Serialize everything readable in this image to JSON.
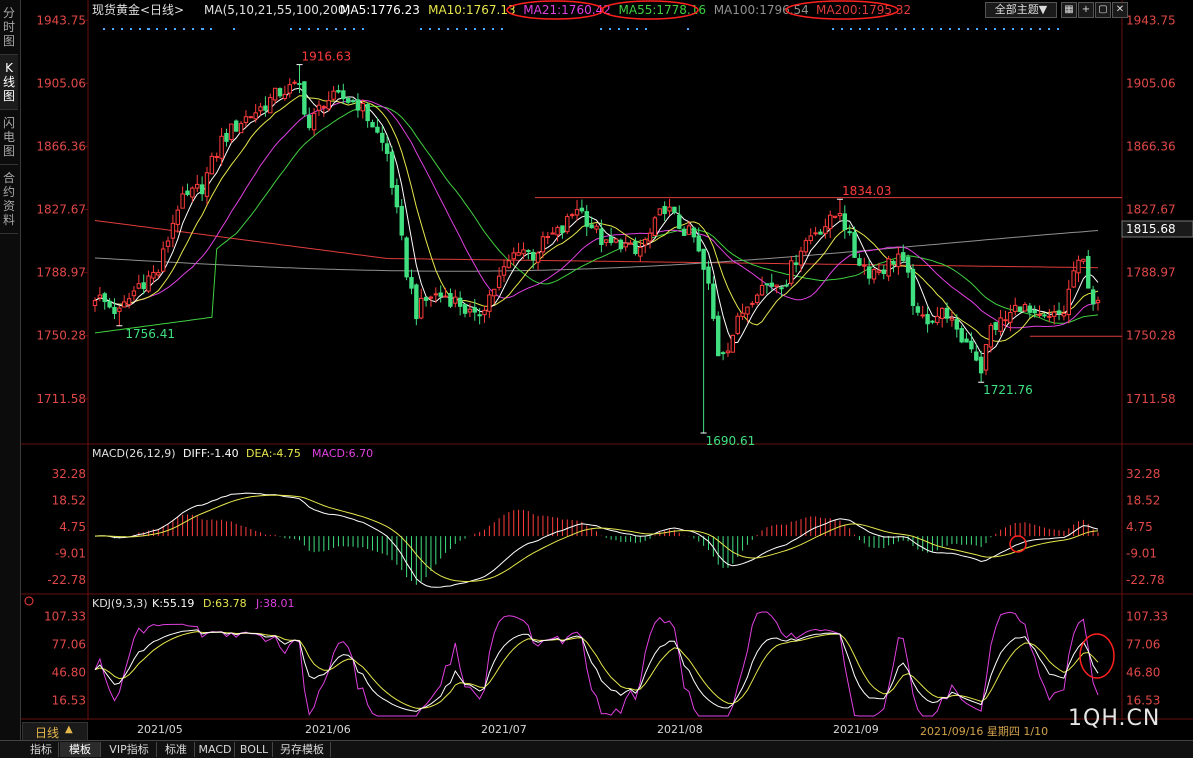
{
  "sidebar": {
    "tabs": [
      {
        "label": "分时图",
        "active": false
      },
      {
        "label": "K线图",
        "active": true
      },
      {
        "label": "闪电图",
        "active": false
      },
      {
        "label": "合约资料",
        "active": false
      }
    ]
  },
  "header": {
    "title": "现货黄金",
    "period": "<日线>",
    "ma_params": "MA(5,10,21,55,100,200)",
    "ma_values": [
      {
        "text": "MA5:1776.23",
        "color": "#ffffff"
      },
      {
        "text": "MA10:1767.13",
        "color": "#e6e64c"
      },
      {
        "text": "MA21:1760.42",
        "color": "#e040e0"
      },
      {
        "text": "MA55:1778.16",
        "color": "#40d040"
      },
      {
        "text": "MA100:1796.54",
        "color": "#909090"
      },
      {
        "text": "MA200:1795.32",
        "color": "#e03c3c"
      }
    ],
    "theme_button": "全部主题▼"
  },
  "macd_header": {
    "name": "MACD(26,12,9)",
    "diff": "DIFF:-1.40",
    "dea": "DEA:-4.75",
    "macd": "MACD:6.70"
  },
  "kdj_header": {
    "name": "KDJ(9,3,3)",
    "k": "K:55.19",
    "d": "D:63.78",
    "j": "J:38.01"
  },
  "bottom": {
    "period_label": "日线",
    "months": [
      "2021/05",
      "2021/06",
      "2021/07",
      "2021/08",
      "2021/09"
    ],
    "date_info": "2021/09/16 星期四 1/10",
    "watermark": "1QH.CN",
    "tabs": [
      "指标",
      "模板",
      "VIP指标",
      "标准",
      "MACD",
      "BOLL",
      "另存模板"
    ],
    "selected_tab": "模板"
  },
  "colors": {
    "up": "#ff3c3c",
    "down": "#40e080",
    "ma5": "#ffffff",
    "ma10": "#e6e64c",
    "ma21": "#e040e0",
    "ma55": "#40d040",
    "ma100": "#909090",
    "ma200": "#e03c3c",
    "axis_text": "#e04848",
    "highlight_circle": "#ff2020"
  },
  "chart_data": [
    {
      "type": "candlestick",
      "title": "现货黄金 日线",
      "ylim": [
        1690,
        1944
      ],
      "y_ticks": [
        1943.75,
        1905.06,
        1866.36,
        1827.67,
        1788.97,
        1750.28,
        1711.58
      ],
      "last_price": "1815.68",
      "annotations": [
        {
          "text": "1916.63",
          "date_index": 42
        },
        {
          "text": "1756.41",
          "date_index": 5
        },
        {
          "text": "1834.03",
          "date_index": 153
        },
        {
          "text": "1690.61",
          "date_index": 125
        },
        {
          "text": "1721.76",
          "date_index": 182
        }
      ],
      "anchors": [
        {
          "i": 0,
          "c": 1775
        },
        {
          "i": 5,
          "c": 1764
        },
        {
          "i": 9,
          "c": 1782
        },
        {
          "i": 13,
          "c": 1790
        },
        {
          "i": 17,
          "c": 1830
        },
        {
          "i": 22,
          "c": 1842
        },
        {
          "i": 26,
          "c": 1870
        },
        {
          "i": 30,
          "c": 1882
        },
        {
          "i": 34,
          "c": 1890
        },
        {
          "i": 38,
          "c": 1900
        },
        {
          "i": 42,
          "c": 1903
        },
        {
          "i": 44,
          "c": 1878
        },
        {
          "i": 47,
          "c": 1895
        },
        {
          "i": 51,
          "c": 1896
        },
        {
          "i": 54,
          "c": 1893
        },
        {
          "i": 57,
          "c": 1880
        },
        {
          "i": 60,
          "c": 1862
        },
        {
          "i": 62,
          "c": 1825
        },
        {
          "i": 64,
          "c": 1790
        },
        {
          "i": 66,
          "c": 1765
        },
        {
          "i": 69,
          "c": 1775
        },
        {
          "i": 72,
          "c": 1775
        },
        {
          "i": 75,
          "c": 1770
        },
        {
          "i": 78,
          "c": 1760
        },
        {
          "i": 81,
          "c": 1775
        },
        {
          "i": 84,
          "c": 1790
        },
        {
          "i": 87,
          "c": 1805
        },
        {
          "i": 90,
          "c": 1800
        },
        {
          "i": 93,
          "c": 1810
        },
        {
          "i": 96,
          "c": 1815
        },
        {
          "i": 99,
          "c": 1830
        },
        {
          "i": 102,
          "c": 1818
        },
        {
          "i": 105,
          "c": 1805
        },
        {
          "i": 108,
          "c": 1808
        },
        {
          "i": 111,
          "c": 1800
        },
        {
          "i": 114,
          "c": 1812
        },
        {
          "i": 117,
          "c": 1830
        },
        {
          "i": 120,
          "c": 1818
        },
        {
          "i": 123,
          "c": 1810
        },
        {
          "i": 126,
          "c": 1780
        },
        {
          "i": 128,
          "c": 1740
        },
        {
          "i": 130,
          "c": 1745
        },
        {
          "i": 133,
          "c": 1765
        },
        {
          "i": 136,
          "c": 1780
        },
        {
          "i": 139,
          "c": 1782
        },
        {
          "i": 142,
          "c": 1785
        },
        {
          "i": 145,
          "c": 1805
        },
        {
          "i": 148,
          "c": 1815
        },
        {
          "i": 151,
          "c": 1820
        },
        {
          "i": 153,
          "c": 1828
        },
        {
          "i": 156,
          "c": 1800
        },
        {
          "i": 159,
          "c": 1790
        },
        {
          "i": 162,
          "c": 1792
        },
        {
          "i": 165,
          "c": 1800
        },
        {
          "i": 167,
          "c": 1785
        },
        {
          "i": 169,
          "c": 1760
        },
        {
          "i": 172,
          "c": 1762
        },
        {
          "i": 175,
          "c": 1765
        },
        {
          "i": 177,
          "c": 1750
        },
        {
          "i": 180,
          "c": 1745
        },
        {
          "i": 182,
          "c": 1730
        },
        {
          "i": 184,
          "c": 1755
        },
        {
          "i": 187,
          "c": 1760
        },
        {
          "i": 190,
          "c": 1770
        },
        {
          "i": 193,
          "c": 1760
        },
        {
          "i": 196,
          "c": 1760
        },
        {
          "i": 199,
          "c": 1765
        },
        {
          "i": 201,
          "c": 1790
        },
        {
          "i": 203,
          "c": 1795
        },
        {
          "i": 205,
          "c": 1772
        },
        {
          "i": 206,
          "c": 1768
        }
      ],
      "count": 207,
      "hline_red": [
        1835,
        1750
      ]
    },
    {
      "type": "macd",
      "y_ticks": [
        32.28,
        18.52,
        4.75,
        -9.01,
        -22.78
      ],
      "ylim": [
        -28,
        38
      ]
    },
    {
      "type": "kdj",
      "y_ticks": [
        107.33,
        77.06,
        46.8,
        16.53
      ],
      "ylim": [
        0,
        112
      ]
    }
  ]
}
